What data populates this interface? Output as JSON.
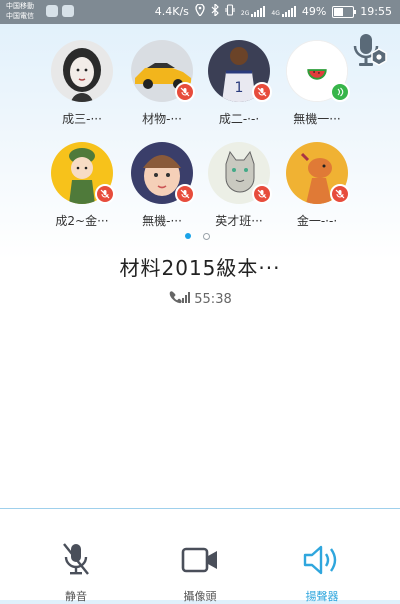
{
  "status_bar": {
    "carrier_1": "中国移動",
    "carrier_2": "中国電信",
    "speed": "4.4K/s",
    "network_1": "2G",
    "network_2": "4G",
    "battery": "49%",
    "battery_level": 0.49,
    "time": "19:55"
  },
  "participants": [
    {
      "name": "成三-···",
      "mic": "muted",
      "avatar_icon": "woman-portrait-avatar"
    },
    {
      "name": "材物-···",
      "mic": "muted",
      "avatar_icon": "yellow-car-avatar"
    },
    {
      "name": "成二-·-·",
      "mic": "muted",
      "avatar_icon": "basketball-player-avatar"
    },
    {
      "name": "無機一···",
      "mic": "active",
      "avatar_icon": "watermelon-avatar"
    },
    {
      "name": "成2~金···",
      "mic": "muted",
      "avatar_icon": "cartoon-soldier-avatar"
    },
    {
      "name": "無機-···",
      "mic": "muted",
      "avatar_icon": "baby-girl-avatar"
    },
    {
      "name": "英才班···",
      "mic": "muted",
      "avatar_icon": "cat-sketch-avatar"
    },
    {
      "name": "金一-·-·",
      "mic": "muted",
      "avatar_icon": "cartoon-dog-avatar"
    }
  ],
  "pager": {
    "pages": 2,
    "current": 1
  },
  "call": {
    "group_name": "材料2015級本···",
    "duration": "55:38"
  },
  "controls": {
    "mute_label": "静音",
    "camera_label": "攝像頭",
    "speaker_label": "揚聲器"
  },
  "colors": {
    "accent": "#2fa6dd",
    "muted_badge": "#e74c3c",
    "active_badge": "#37b54a",
    "statusbar": "#7f8a93"
  }
}
